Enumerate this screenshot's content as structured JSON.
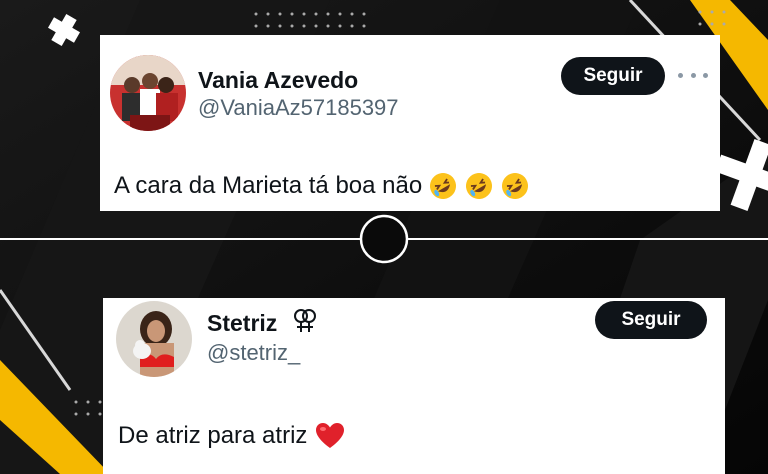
{
  "tweets": [
    {
      "name": "Vania Azevedo",
      "handle": "@VaniaAz57185397",
      "follow_label": "Seguir",
      "text": "A cara da Marieta tá boa não",
      "emojis": [
        "rofl-emoji",
        "rofl-emoji",
        "rofl-emoji"
      ]
    },
    {
      "name": "Stetriz",
      "name_icon": "doubled-female-sign-icon",
      "handle": "@stetriz_",
      "follow_label": "Seguir",
      "text": "De atriz para atriz",
      "emojis": [
        "red-heart-emoji"
      ]
    }
  ],
  "colors": {
    "background": "#0a0a0a",
    "accent_yellow": "#f5b800",
    "button_bg": "#0f1419",
    "handle_gray": "#536471"
  }
}
